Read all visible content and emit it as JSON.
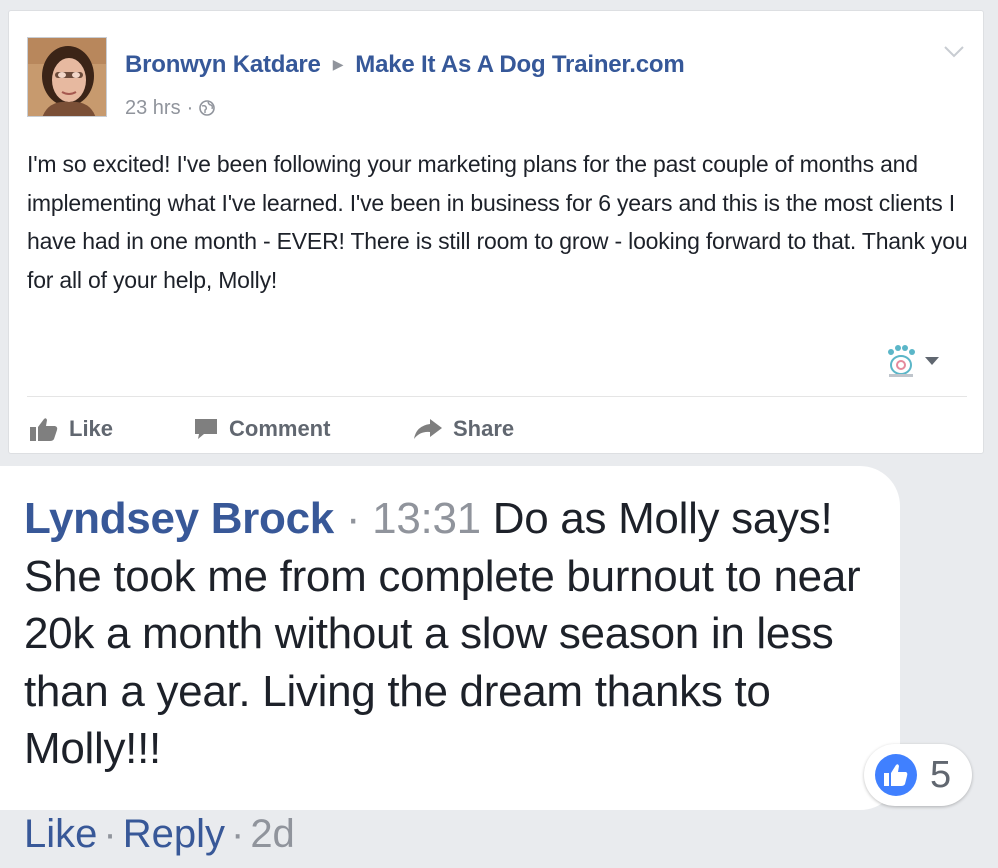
{
  "post": {
    "author": "Bronwyn Katdare",
    "target_page": "Make It As A Dog Trainer.com",
    "time": "23 hrs",
    "separator": "·",
    "icons": {
      "privacy": "globe-icon",
      "menu": "chevron-down-icon",
      "reaction": "paw-icon"
    },
    "text": "I'm so excited! I've been following your marketing plans for the past couple of months and implementing what I've learned. I've been in business for 6 years and this is the most clients I have had in one month - EVER! There is still room to grow - looking forward to that. Thank you for all of your help, Molly!",
    "actions": {
      "like": "Like",
      "comment": "Comment",
      "share": "Share"
    }
  },
  "comment": {
    "author": "Lyndsey Brock",
    "separator": "·",
    "time": "13:31",
    "text": "Do as Molly says! She took me from complete burnout to near 20k a month without a slow season in less than a year. Living the dream thanks to Molly!!!",
    "like_count": "5",
    "actions": {
      "like": "Like",
      "reply": "Reply",
      "age": "2d",
      "separator": "·"
    }
  },
  "colors": {
    "link_blue": "#365899",
    "meta_gray": "#90949c",
    "text": "#1d2129",
    "like_blue": "#4080ff",
    "background": "#e9ebee"
  }
}
